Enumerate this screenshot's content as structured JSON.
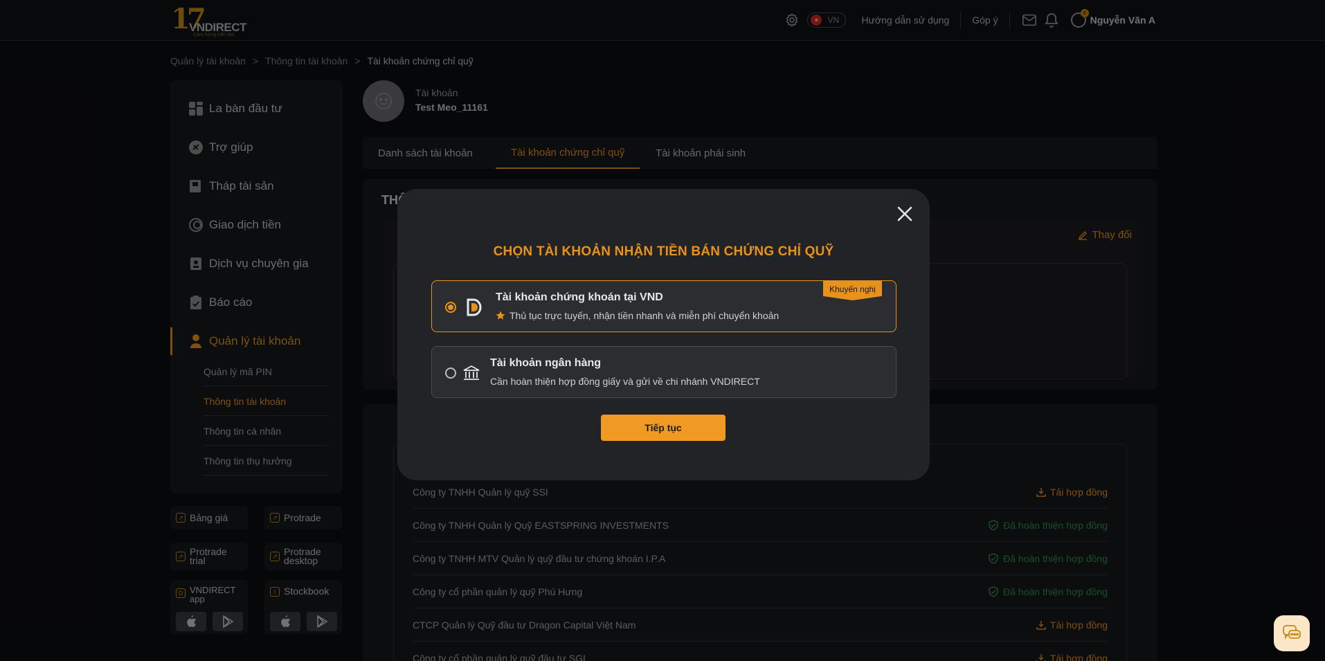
{
  "header": {
    "logo_number": "17",
    "logo_word": "VNDIRECT",
    "logo_tagline": "Cảm hứng kiến tạo",
    "lang": "VN",
    "guide_link": "Hướng dẫn sử dụng",
    "feedback_link": "Góp ý",
    "user_name": "Nguyễn Văn A",
    "notification_count": "0"
  },
  "breadcrumb": {
    "items": [
      "Quản lý tài khoản",
      "Thông tin tài khoản",
      "Tài khoản chứng chỉ quỹ"
    ],
    "separator": ">"
  },
  "sidebar": {
    "items": [
      {
        "label": "La bàn đầu tư",
        "icon": "dashboard-icon"
      },
      {
        "label": "Trợ giúp",
        "icon": "help-icon"
      },
      {
        "label": "Tháp tài sản",
        "icon": "asset-icon"
      },
      {
        "label": "Giao dịch tiền",
        "icon": "money-icon"
      },
      {
        "label": "Dịch vụ chuyên gia",
        "icon": "expert-icon"
      },
      {
        "label": "Báo cáo",
        "icon": "report-icon"
      },
      {
        "label": "Quản lý tài khoản",
        "icon": "user-icon"
      }
    ],
    "sub_items": [
      {
        "label": "Quản lý mã PIN"
      },
      {
        "label": "Thông tin tài khoản"
      },
      {
        "label": "Thông tin cá nhân"
      },
      {
        "label": "Thông tin thụ hưởng"
      }
    ]
  },
  "tiles": {
    "bang_gia": "Bảng giá",
    "protrade": "Protrade",
    "protrade_trial_1": "Protrade",
    "protrade_trial_2": "trial",
    "protrade_desktop_1": "Protrade",
    "protrade_desktop_2": "desktop",
    "vndirect_app_1": "VNDIRECT",
    "vndirect_app_2": "app",
    "stockbook": "Stockbook"
  },
  "account": {
    "label": "Tài khoản",
    "name": "Test Meo_11161"
  },
  "tabs": [
    "Danh sách tài khoản",
    "Tài khoản chứng chỉ quỹ",
    "Tài khoản phái sinh"
  ],
  "panel": {
    "title_partial": "THÔ",
    "change_label": "Thay đổi"
  },
  "fund_list": [
    {
      "name": "Công ty TNHH Quản lý quỹ SSI",
      "action": "Tải hợp đồng",
      "status": "download"
    },
    {
      "name": "Công ty TNHH Quản lý Quỹ EASTSPRING INVESTMENTS",
      "action": "Đã hoàn thiện hợp đồng",
      "status": "done"
    },
    {
      "name": "Công ty TNHH MTV Quản lý quỹ đầu tư chứng khoán I.P.A",
      "action": "Đã hoàn thiện hợp đồng",
      "status": "done"
    },
    {
      "name": "Công ty cổ phần quản lý quỹ Phú Hưng",
      "action": "Đã hoàn thiện hợp đồng",
      "status": "done"
    },
    {
      "name": "CTCP Quản lý Quỹ đầu tư Dragon Capital Việt Nam",
      "action": "Tải hợp đồng",
      "status": "download"
    },
    {
      "name": "Công ty cổ phần quản lý quỹ đầu tư SGI",
      "action": "Tải hợp đồng",
      "status": "download"
    }
  ],
  "modal": {
    "title": "CHỌN TÀI KHOẢN NHẬN TIỀN BÁN CHỨNG CHỈ QUỸ",
    "option_vnd": {
      "title": "Tài khoản chứng khoán tại VND",
      "desc": "Thủ tục trực tuyến, nhận tiền nhanh và miễn phí chuyển khoản",
      "badge": "Khuyến nghị",
      "selected": true
    },
    "option_bank": {
      "title": "Tài khoản ngân hàng",
      "desc": "Cần hoàn thiện hợp đồng giấy và gửi về chi nhánh VNDIRECT",
      "selected": false
    },
    "continue_label": "Tiếp tục"
  },
  "colors": {
    "accent": "#e8921e",
    "success": "#2e8f4a",
    "background": "#0c0d10"
  }
}
